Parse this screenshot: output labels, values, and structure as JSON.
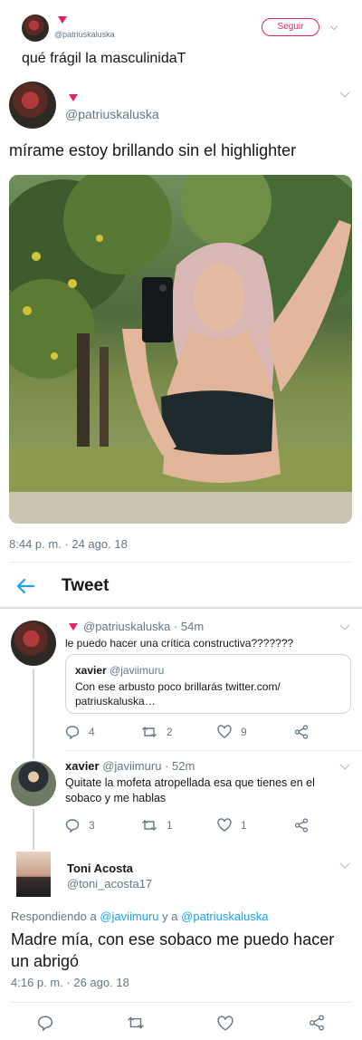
{
  "top_tweet": {
    "handle": "@patriuskaluska",
    "follow_label": "Seguir",
    "text": "qué frágil la masculinidaT"
  },
  "quoted_tweet": {
    "handle": "@patriuskaluska",
    "text": "mírame estoy brillando sin el highlighter",
    "timestamp": "8:44 p. m. · 24 ago. 18"
  },
  "header": {
    "title": "Tweet"
  },
  "replies": [
    {
      "name": "",
      "handle": "@patriuskaluska",
      "time": "· 54m",
      "text": "le puedo hacer una crítica constructiva???????",
      "quote": {
        "name": "xavier",
        "handle": "@javiimuru",
        "text": "Con ese arbusto poco brillarás twitter.com/ patriuskaluska…"
      },
      "counts": {
        "reply": "4",
        "retweet": "2",
        "like": "9"
      }
    },
    {
      "name": "xavier",
      "handle": "@javiimuru",
      "time": "· 52m",
      "text": "Quitate la mofeta atropellada esa que tienes en el sobaco y me hablas",
      "counts": {
        "reply": "3",
        "retweet": "1",
        "like": "1"
      }
    }
  ],
  "main_tweet": {
    "name": "Toni Acosta",
    "handle": "@toni_acosta17",
    "replying_prefix": "Respondiendo a",
    "replying_user1": "@javiimuru",
    "replying_and": "y a",
    "replying_user2": "@patriuskaluska",
    "text": "Madre mía, con ese sobaco me puedo hacer un abrigó",
    "timestamp": "4:16 p. m. · 26 ago. 18"
  },
  "icons": [
    "back-arrow-icon",
    "reply-icon",
    "retweet-icon",
    "like-icon",
    "share-icon",
    "chevron-down-icon",
    "verified-triangle-icon"
  ],
  "colors": {
    "accent": "#1da1f2",
    "follow": "#e0245e",
    "text": "#14171a",
    "muted": "#657786"
  }
}
